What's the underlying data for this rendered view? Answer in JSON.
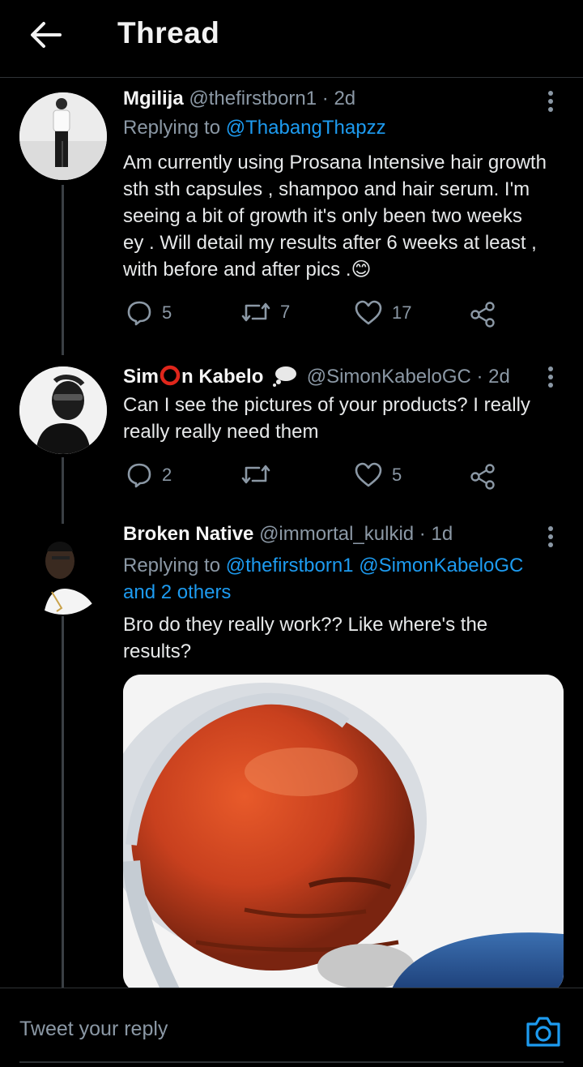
{
  "header": {
    "title": "Thread"
  },
  "colors": {
    "accent": "#1d9bf0",
    "muted": "#8b98a5",
    "background": "#000000"
  },
  "tweets": [
    {
      "name": "Mgilija",
      "meta": "@thefirstborn1 · 2d",
      "replying_prefix": "Replying to ",
      "replying_to": "@ThabangThapzz",
      "lines": [
        "Am currently using Prosana Intensive hair growth",
        "sth sth capsules , shampoo and hair serum. I'm",
        "seeing a bit of growth it's only been two weeks",
        "ey . Will detail my results after 6 weeks at least ,",
        "with before and after pics ."
      ],
      "emoji": "😊",
      "replies": "5",
      "retweets": "7",
      "likes": "17"
    },
    {
      "name_part1": "Sim",
      "name_part2": "n Kabelo",
      "meta": "@SimonKabeloGC · 2d",
      "lines": [
        "Can I see the pictures of your products? I really",
        "really really need them"
      ],
      "replies": "2",
      "retweets": "",
      "likes": "5"
    },
    {
      "name": "Broken Native",
      "meta": "@immortal_kulkid · 1d",
      "replying_prefix": "Replying to ",
      "replying_to_1": "@thefirstborn1",
      "replying_to_2": "@SimonKabeloGC",
      "replying_to_3": "and 2 others",
      "lines": [
        "Bro do they really work?? Like where's the",
        "results?"
      ]
    }
  ],
  "reply_bar": {
    "placeholder": "Tweet your reply"
  },
  "icons": {
    "back": "arrow-left-icon",
    "more": "more-vertical-icon",
    "reply": "reply-bubble-icon",
    "retweet": "retweet-icon",
    "like": "heart-icon",
    "share": "share-icon",
    "camera": "camera-icon"
  }
}
